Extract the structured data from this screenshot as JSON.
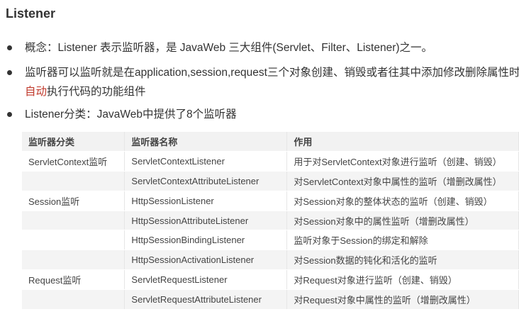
{
  "title": "Listener",
  "bullets": [
    {
      "text": "概念：Listener 表示监听器，是 JavaWeb 三大组件(Servlet、Filter、Listener)之一。"
    },
    {
      "before": "监听器可以监听就是在application,session,request三个对象创建、销毁或者往其中添加修改删除属性时",
      "highlight": "自动",
      "after": "执行代码的功能组件"
    },
    {
      "text": "Listener分类：JavaWeb中提供了8个监听器"
    }
  ],
  "highlight_color": "#c0392b",
  "table": {
    "headers": [
      "监听器分类",
      "监听器名称",
      "作用"
    ],
    "rows": [
      [
        "ServletContext监听",
        "ServletContextListener",
        "用于对ServletContext对象进行监听（创建、销毁）"
      ],
      [
        "",
        "ServletContextAttributeListener",
        "对ServletContext对象中属性的监听（增删改属性）"
      ],
      [
        "Session监听",
        "HttpSessionListener",
        "对Session对象的整体状态的监听（创建、销毁）"
      ],
      [
        "",
        "HttpSessionAttributeListener",
        "对Session对象中的属性监听（增删改属性）"
      ],
      [
        "",
        "HttpSessionBindingListener",
        "监听对象于Session的绑定和解除"
      ],
      [
        "",
        "HttpSessionActivationListener",
        "对Session数据的钝化和活化的监听"
      ],
      [
        "Request监听",
        "ServletRequestListener",
        "对Request对象进行监听（创建、销毁）"
      ],
      [
        "",
        "ServletRequestAttributeListener",
        "对Request对象中属性的监听（增删改属性）"
      ]
    ]
  }
}
